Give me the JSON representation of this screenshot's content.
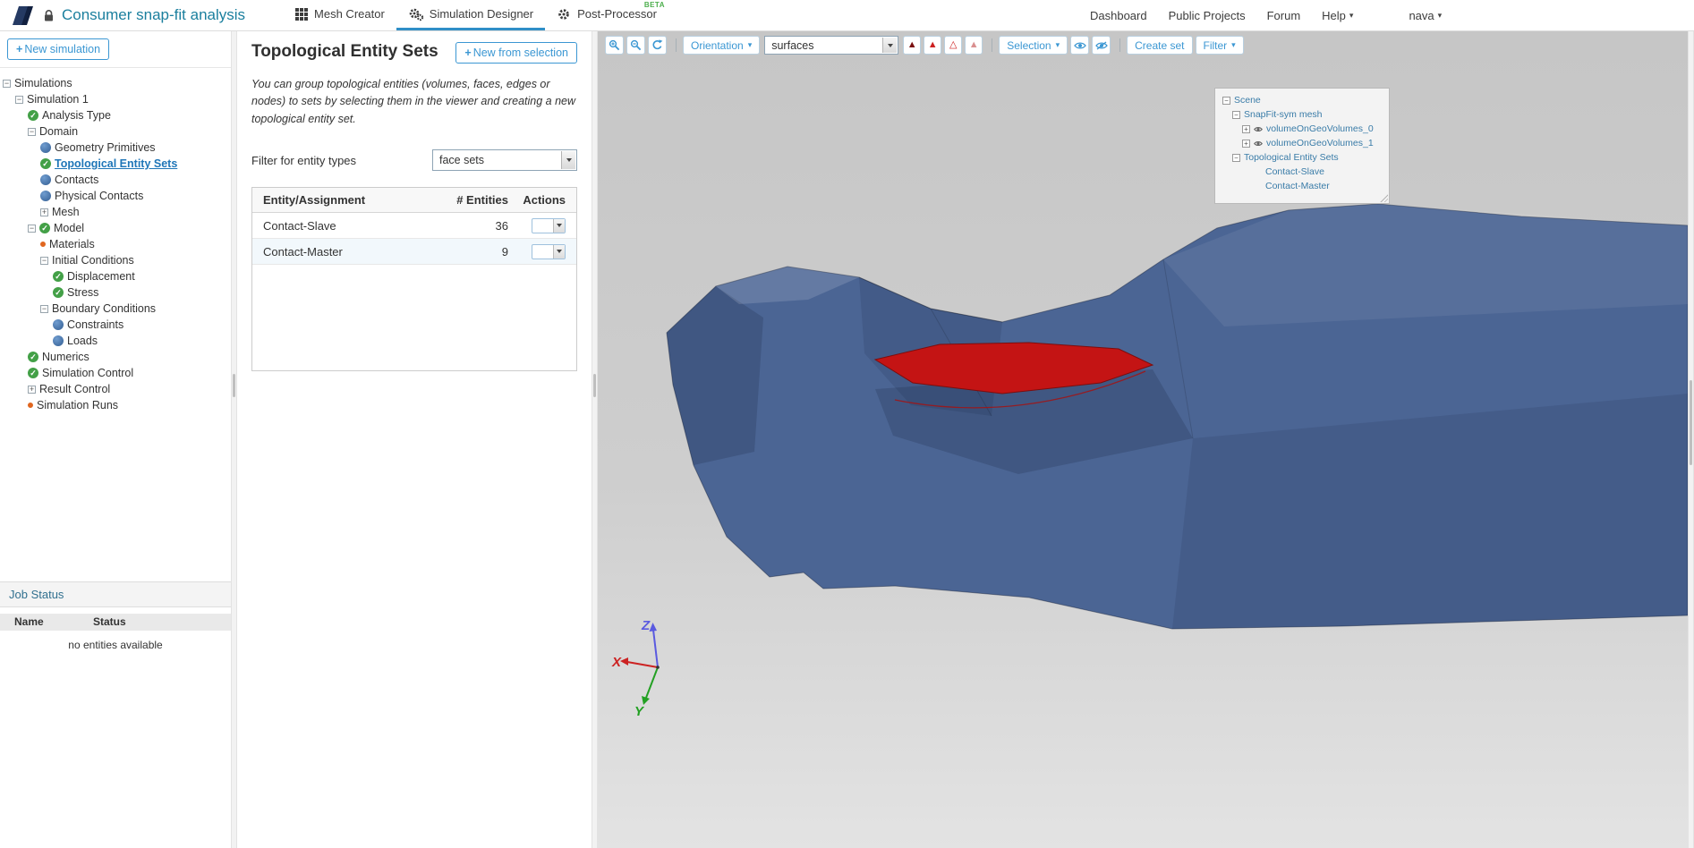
{
  "topbar": {
    "title": "Consumer snap-fit analysis",
    "tabs": [
      {
        "label": "Mesh Creator"
      },
      {
        "label": "Simulation Designer"
      },
      {
        "label": "Post-Processor",
        "badge": "BETA"
      }
    ],
    "links": {
      "dashboard": "Dashboard",
      "public_projects": "Public Projects",
      "forum": "Forum",
      "help": "Help",
      "user": "nava"
    }
  },
  "sidebar": {
    "new_simulation": "New simulation",
    "tree": [
      {
        "label": "Simulations"
      },
      {
        "label": "Simulation 1"
      },
      {
        "label": "Analysis Type"
      },
      {
        "label": "Domain"
      },
      {
        "label": "Geometry Primitives"
      },
      {
        "label": "Topological Entity Sets"
      },
      {
        "label": "Contacts"
      },
      {
        "label": "Physical Contacts"
      },
      {
        "label": "Mesh"
      },
      {
        "label": "Model"
      },
      {
        "label": "Materials"
      },
      {
        "label": "Initial Conditions"
      },
      {
        "label": "Displacement"
      },
      {
        "label": "Stress"
      },
      {
        "label": "Boundary Conditions"
      },
      {
        "label": "Constraints"
      },
      {
        "label": "Loads"
      },
      {
        "label": "Numerics"
      },
      {
        "label": "Simulation Control"
      },
      {
        "label": "Result Control"
      },
      {
        "label": "Simulation Runs"
      }
    ],
    "job_status": {
      "title": "Job Status",
      "col_name": "Name",
      "col_status": "Status",
      "empty": "no entities available"
    }
  },
  "panel": {
    "title": "Topological Entity Sets",
    "new_from_selection": "New from selection",
    "description": "You can group topological entities (volumes, faces, edges or nodes) to sets by selecting them in the viewer and creating a new topological entity set.",
    "filter_label": "Filter for entity types",
    "filter_value": "face sets",
    "table": {
      "col_entity": "Entity/Assignment",
      "col_count": "# Entities",
      "col_actions": "Actions",
      "rows": [
        {
          "name": "Contact-Slave",
          "count": "36"
        },
        {
          "name": "Contact-Master",
          "count": "9"
        }
      ]
    }
  },
  "viewer": {
    "toolbar": {
      "orientation": "Orientation",
      "display_mode": "surfaces",
      "selection": "Selection",
      "create_set": "Create set",
      "filter": "Filter"
    },
    "scene_tree": {
      "scene": "Scene",
      "mesh": "SnapFit-sym mesh",
      "volume0": "volumeOnGeoVolumes_0",
      "volume1": "volumeOnGeoVolumes_1",
      "topo": "Topological Entity Sets",
      "slave": "Contact-Slave",
      "master": "Contact-Master"
    },
    "axis": {
      "x": "X",
      "y": "Y",
      "z": "Z"
    }
  },
  "icons": {
    "plus": "+",
    "collapse": "−",
    "expand": "+",
    "check": "✓",
    "caret": "▾",
    "triangle_solid": "▲",
    "triangle_outline": "△",
    "zoom_in": "svg-magnifier-plus",
    "zoom_out": "svg-magnifier-minus",
    "refresh": "svg-refresh-arrow",
    "eye": "svg-eye",
    "eye_slash": "svg-eye-slash"
  },
  "colors": {
    "accent_blue": "#3b97d3",
    "title_teal": "#1b7f9e",
    "mesh_blue": "#4b6594",
    "highlight_red": "#c41414",
    "status_green": "#43a047",
    "item_blue": "#335e93",
    "pending_orange": "#e0661f",
    "beta_green": "#4cae4c"
  }
}
